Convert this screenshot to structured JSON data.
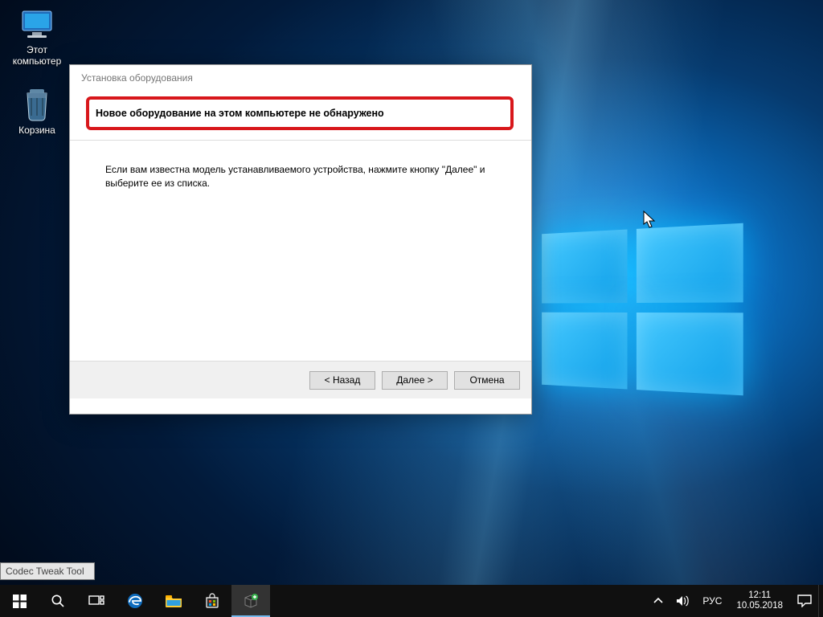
{
  "desktop": {
    "icons": {
      "this_pc": "Этот компьютер",
      "recycle_bin": "Корзина"
    }
  },
  "dialog": {
    "title": "Установка оборудования",
    "headline": "Новое оборудование на этом компьютере не обнаружено",
    "body_text": "Если вам известна модель устанавливаемого устройства, нажмите кнопку \"Далее\" и выберите ее из списка.",
    "buttons": {
      "back": "< Назад",
      "next": "Далее >",
      "cancel": "Отмена"
    },
    "highlight_color": "#d8171b"
  },
  "tooltip": {
    "text": "Codec Tweak Tool"
  },
  "taskbar": {
    "language": "РУС"
  },
  "clock": {
    "time": "12:11",
    "date": "10.05.2018"
  }
}
